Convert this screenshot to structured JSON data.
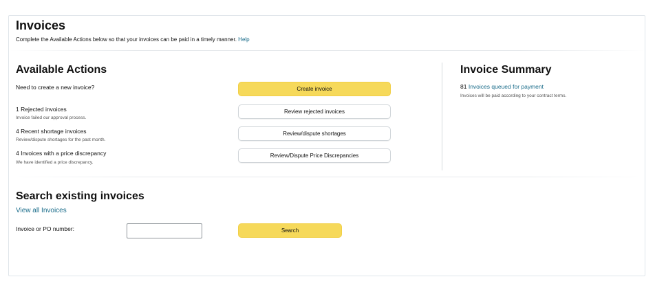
{
  "header": {
    "title": "Invoices",
    "subtitle": "Complete the Available Actions below so that your invoices can be paid in a timely manner.",
    "help_link": "Help"
  },
  "actions": {
    "heading": "Available Actions",
    "create": {
      "label": "Need to create a new invoice?",
      "button": "Create invoice"
    },
    "rejected": {
      "label": "1 Rejected invoices",
      "hint": "Invoice failed our approval process.",
      "button": "Review rejected invoices"
    },
    "shortage": {
      "label": "4 Recent shortage invoices",
      "hint": "Review/dispute shortages for the past month.",
      "button": "Review/dispute shortages"
    },
    "discrepancy": {
      "label": "4 Invoices with a price discrepancy",
      "hint": "We have identified a price discrepancy.",
      "button": "Review/Dispute Price Discrepancies"
    }
  },
  "summary": {
    "heading": "Invoice Summary",
    "count": "81",
    "queued_link": "Invoices queued for payment",
    "note": "Invoices will be paid according to your contract terms."
  },
  "search": {
    "heading": "Search existing invoices",
    "view_all": "View all Invoices",
    "field_label": "Invoice or PO number:",
    "field_value": "",
    "button": "Search"
  },
  "colors": {
    "primary_button": "#f6d95a",
    "link": "#1a6c8a",
    "border": "#dfe5ea"
  }
}
